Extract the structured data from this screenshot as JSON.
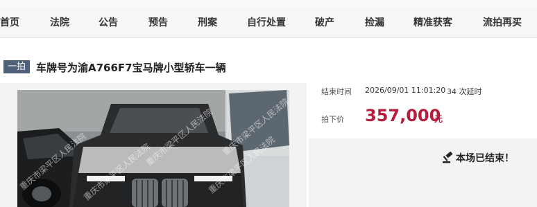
{
  "nav": {
    "items": [
      "首页",
      "法院",
      "公告",
      "预告",
      "刑案",
      "自行处置",
      "破产",
      "捡漏",
      "精准获客",
      "流拍再买"
    ]
  },
  "auction": {
    "round_badge": "一拍",
    "title": "车牌号为渝A766F7宝马牌小型轿车一辆",
    "end_time_label": "结束时间",
    "end_time_value": "2026/09/01 11:01:20",
    "delay_text": "34 次延时",
    "deal_price_label": "拍下价",
    "deal_price": "357,000",
    "currency_unit": "元",
    "status": "本场已结束！",
    "watermark": "重庆市梁平区人民法院"
  },
  "colors": {
    "price": "#b41e3c",
    "badge_bg": "#4f6179"
  },
  "icons": {
    "status": "gavel-icon"
  }
}
